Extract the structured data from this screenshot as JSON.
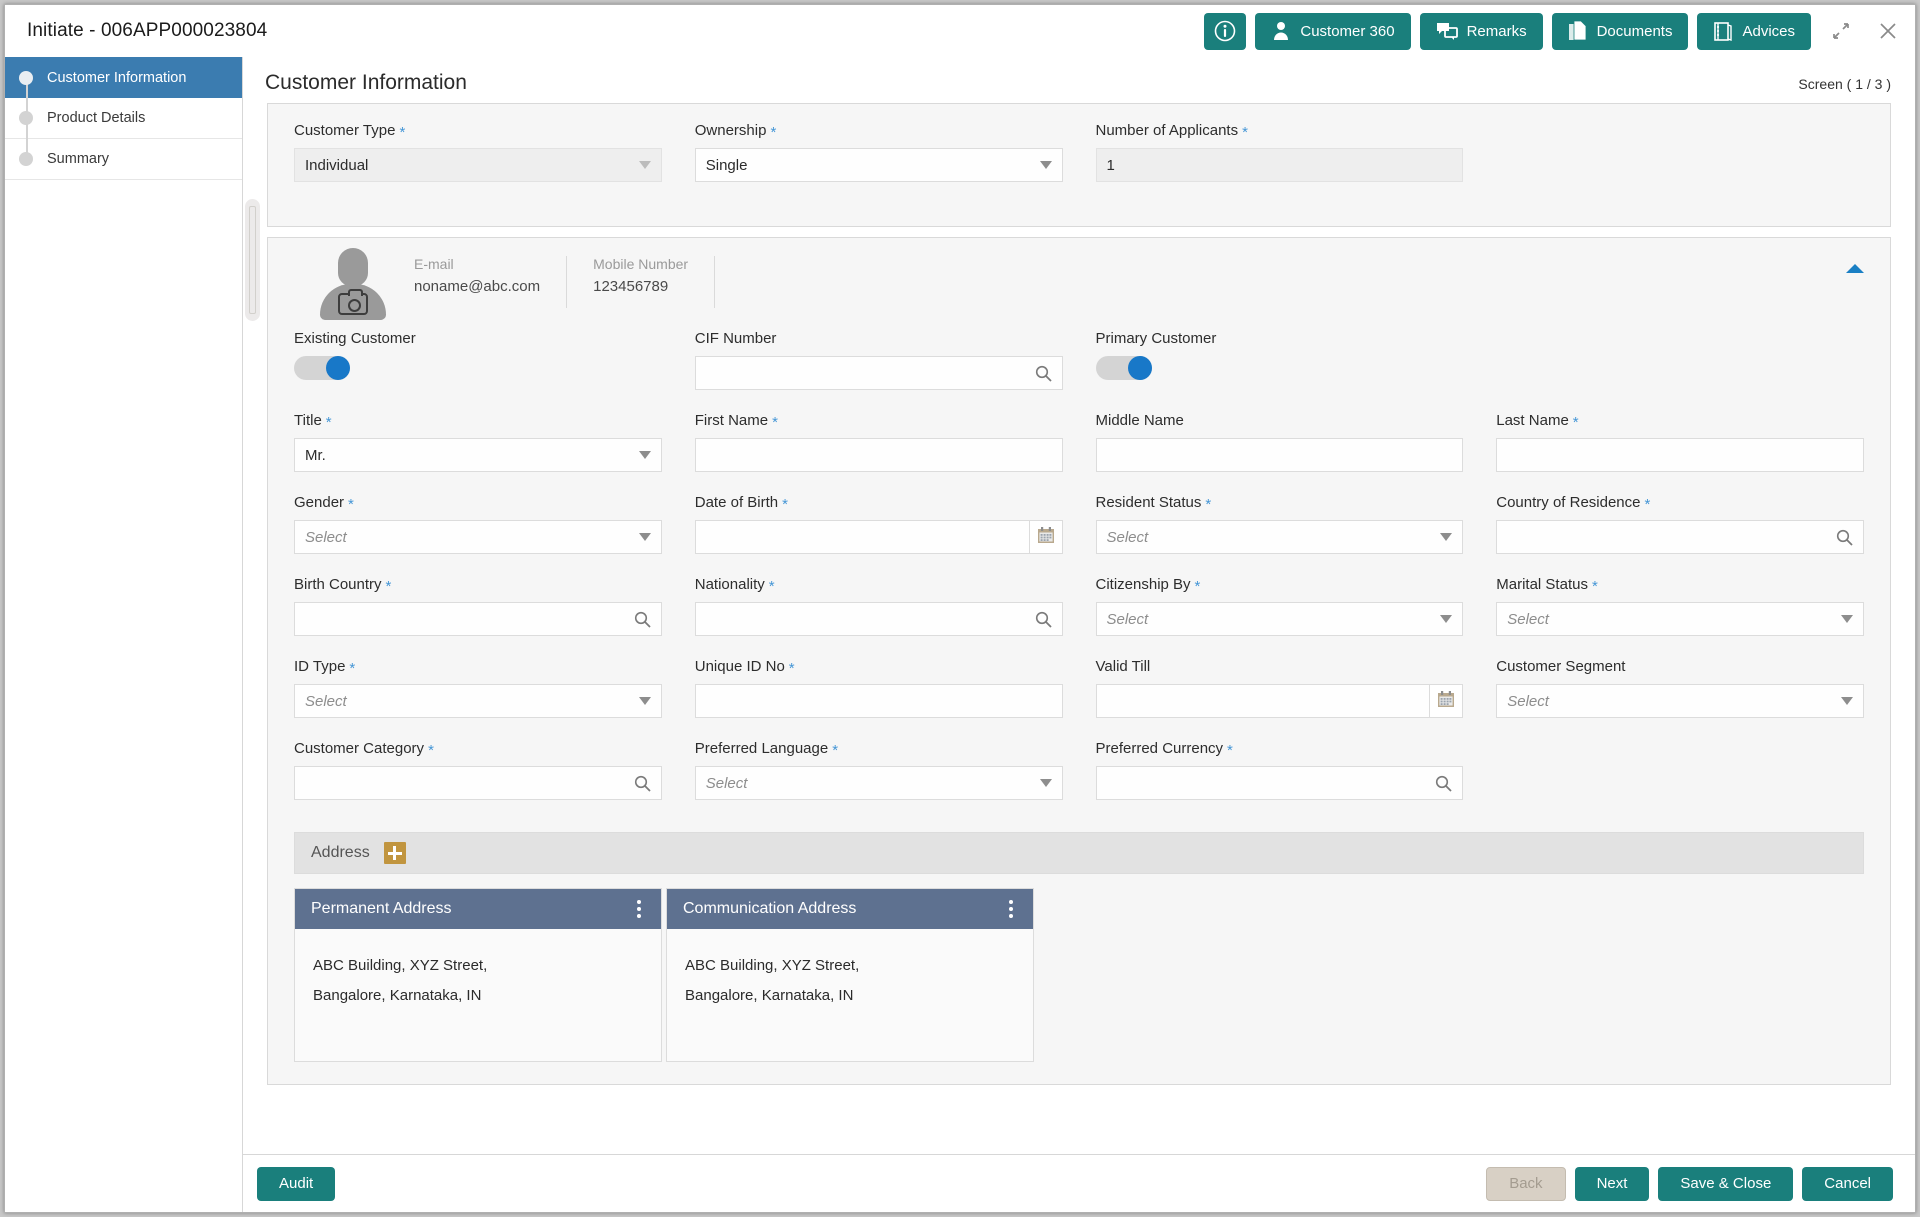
{
  "titlebar": {
    "title": "Initiate - 006APP000023804",
    "buttons": [
      {
        "label": "",
        "icon": "info-icon",
        "name": "info-button"
      },
      {
        "label": "Customer 360",
        "icon": "person-icon",
        "name": "customer-360-button"
      },
      {
        "label": "Remarks",
        "icon": "chat-icon",
        "name": "remarks-button"
      },
      {
        "label": "Documents",
        "icon": "documents-icon",
        "name": "documents-button"
      },
      {
        "label": "Advices",
        "icon": "advices-icon",
        "name": "advices-button"
      }
    ],
    "minimize_icon": "collapse-arrows-icon",
    "close_icon": "close-icon"
  },
  "sidebar": {
    "items": [
      {
        "label": "Customer Information",
        "active": true
      },
      {
        "label": "Product Details",
        "active": false
      },
      {
        "label": "Summary",
        "active": false
      }
    ]
  },
  "main": {
    "page_title": "Customer Information",
    "screen_count": "Screen ( 1 / 3 )"
  },
  "top_fields": [
    {
      "label": "Customer Type",
      "required": true,
      "type": "select",
      "value": "Individual",
      "disabled": true
    },
    {
      "label": "Ownership",
      "required": true,
      "type": "select",
      "value": "Single",
      "disabled": false
    },
    {
      "label": "Number of Applicants",
      "required": true,
      "type": "text",
      "value": "1",
      "disabled": true
    }
  ],
  "customer_header": {
    "avatar_icon": "avatar-camera-icon",
    "email_label": "E-mail",
    "email_value": "noname@abc.com",
    "mobile_label": "Mobile Number",
    "mobile_value": "123456789",
    "collapse_icon": "chevron-up-icon"
  },
  "toggles": {
    "existing_customer_label": "Existing Customer",
    "existing_customer_on": true,
    "primary_customer_label": "Primary Customer",
    "primary_customer_on": true
  },
  "cif": {
    "label": "CIF Number",
    "required": false,
    "value": "",
    "icon": "search-icon"
  },
  "fields": [
    {
      "label": "Title",
      "required": true,
      "type": "select",
      "value": "Mr.",
      "placeholder": ""
    },
    {
      "label": "First Name",
      "required": true,
      "type": "text",
      "value": "",
      "placeholder": ""
    },
    {
      "label": "Middle Name",
      "required": false,
      "type": "text",
      "value": "",
      "placeholder": ""
    },
    {
      "label": "Last Name",
      "required": true,
      "type": "text",
      "value": "",
      "placeholder": ""
    },
    {
      "label": "Gender",
      "required": true,
      "type": "select",
      "value": "",
      "placeholder": "Select"
    },
    {
      "label": "Date of Birth",
      "required": true,
      "type": "date",
      "value": "",
      "placeholder": ""
    },
    {
      "label": "Resident Status",
      "required": true,
      "type": "select",
      "value": "",
      "placeholder": "Select"
    },
    {
      "label": "Country of Residence",
      "required": true,
      "type": "search",
      "value": "",
      "placeholder": ""
    },
    {
      "label": "Birth Country",
      "required": true,
      "type": "search",
      "value": "",
      "placeholder": ""
    },
    {
      "label": "Nationality",
      "required": true,
      "type": "search",
      "value": "",
      "placeholder": ""
    },
    {
      "label": "Citizenship By",
      "required": true,
      "type": "select",
      "value": "",
      "placeholder": "Select"
    },
    {
      "label": "Marital Status",
      "required": true,
      "type": "select",
      "value": "",
      "placeholder": "Select"
    },
    {
      "label": "ID Type",
      "required": true,
      "type": "select",
      "value": "",
      "placeholder": "Select"
    },
    {
      "label": "Unique ID No",
      "required": true,
      "type": "text",
      "value": "",
      "placeholder": ""
    },
    {
      "label": "Valid Till",
      "required": false,
      "type": "date",
      "value": "",
      "placeholder": ""
    },
    {
      "label": "Customer Segment",
      "required": false,
      "type": "select",
      "value": "",
      "placeholder": "Select"
    },
    {
      "label": "Customer Category",
      "required": true,
      "type": "search",
      "value": "",
      "placeholder": ""
    },
    {
      "label": "Preferred Language",
      "required": true,
      "type": "select",
      "value": "",
      "placeholder": "Select"
    },
    {
      "label": "Preferred Currency",
      "required": true,
      "type": "search",
      "value": "",
      "placeholder": ""
    }
  ],
  "address": {
    "section_label": "Address",
    "add_icon": "plus-icon",
    "cards": [
      {
        "title": "Permanent Address",
        "line1": "ABC Building, XYZ Street,",
        "line2": "Bangalore, Karnataka, IN",
        "menu_icon": "kebab-menu-icon"
      },
      {
        "title": "Communication Address",
        "line1": "ABC Building, XYZ Street,",
        "line2": "Bangalore, Karnataka, IN",
        "menu_icon": "kebab-menu-icon"
      }
    ]
  },
  "footer": {
    "audit": "Audit",
    "back": "Back",
    "next": "Next",
    "save_close": "Save & Close",
    "cancel": "Cancel",
    "back_disabled": true
  },
  "colors": {
    "teal": "#1a7f7c",
    "sidebar_active": "#3b7cb0",
    "toggle_on": "#1878c8",
    "card_header": "#5e7190",
    "gold": "#c1953f",
    "required_star": "#4596d6"
  }
}
